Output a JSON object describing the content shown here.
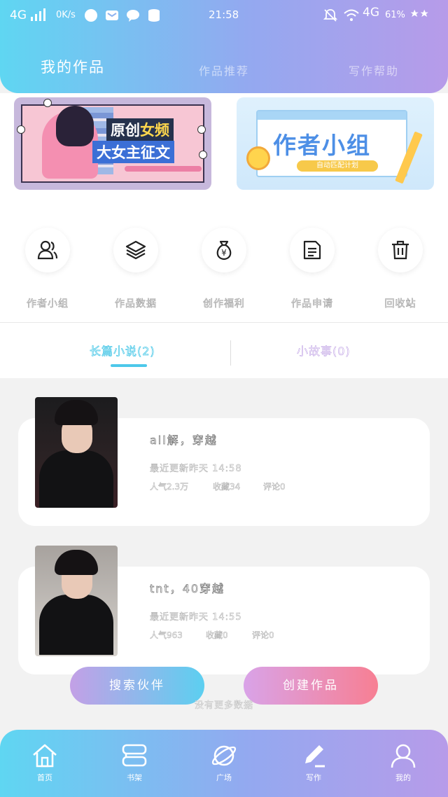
{
  "status_bar": {
    "network": "4G",
    "speed": "0K/s",
    "time": "21:58",
    "network_right": "4G",
    "battery": "61%"
  },
  "top_tabs": [
    {
      "label": "我的作品"
    },
    {
      "label": "作品推荐"
    },
    {
      "label": "写作帮助"
    }
  ],
  "banners": {
    "banner1": {
      "line1_a": "原创",
      "line1_b": "女频",
      "line2": "大女主征文"
    },
    "banner2": {
      "title": "作者小组",
      "pill": "自动匹配计划"
    }
  },
  "quick_actions": [
    {
      "label": "作者小组",
      "icon": "users-icon"
    },
    {
      "label": "作品数据",
      "icon": "layers-icon"
    },
    {
      "label": "创作福利",
      "icon": "money-bag-icon"
    },
    {
      "label": "作品申请",
      "icon": "document-icon"
    },
    {
      "label": "回收站",
      "icon": "trash-icon"
    }
  ],
  "sub_tabs": {
    "active": "长篇小说(2)",
    "inactive": "小故事(0)"
  },
  "works": [
    {
      "title": "all解，穿越",
      "updated": "最近更新昨天 14:58",
      "popularity": "人气2.3万",
      "favorites": "收藏34",
      "comments": "评论0"
    },
    {
      "title": "tnt，40穿越",
      "updated": "最近更新昨天 14:55",
      "popularity": "人气963",
      "favorites": "收藏0",
      "comments": "评论0"
    }
  ],
  "buttons": {
    "partner": "搜索伙伴",
    "create": "创建作品"
  },
  "no_more": "没有更多数据",
  "bottom_nav": [
    {
      "label": "首页",
      "icon": "home-icon"
    },
    {
      "label": "书架",
      "icon": "bookshelf-icon"
    },
    {
      "label": "广场",
      "icon": "planet-icon"
    },
    {
      "label": "写作",
      "icon": "pen-icon"
    },
    {
      "label": "我的",
      "icon": "user-icon"
    }
  ],
  "colors": {
    "gradient_start": "#5fd6f2",
    "gradient_end": "#b79be9",
    "accent_cyan": "#4dc8ea",
    "accent_pink": "#f77f93"
  }
}
